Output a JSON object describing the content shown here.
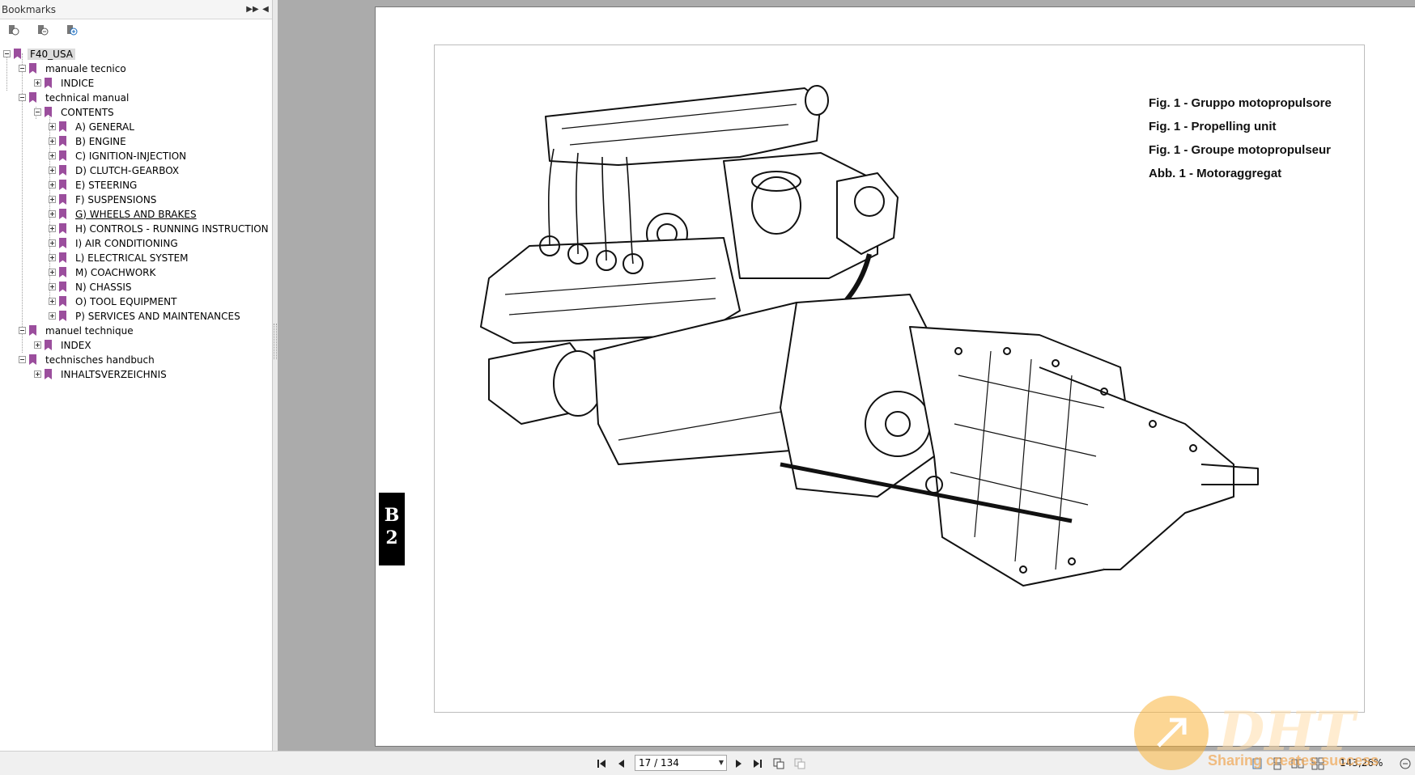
{
  "sidebar": {
    "title": "Bookmarks",
    "header_buttons": [
      "options-icon",
      "collapse-panel-icon"
    ],
    "tools": [
      "expand-bookmark-icon",
      "find-bookmark-icon",
      "add-bookmark-icon"
    ],
    "tree": [
      {
        "label": "F40_USA"
      },
      {
        "label": "manuale tecnico"
      },
      {
        "label": "INDICE"
      },
      {
        "label": "technical manual"
      },
      {
        "label": "CONTENTS"
      },
      {
        "label": "A) GENERAL"
      },
      {
        "label": "B) ENGINE"
      },
      {
        "label": "C) IGNITION-INJECTION"
      },
      {
        "label": "D) CLUTCH-GEARBOX"
      },
      {
        "label": "E) STEERING"
      },
      {
        "label": "F) SUSPENSIONS"
      },
      {
        "label": "G) WHEELS AND BRAKES"
      },
      {
        "label": "H) CONTROLS - RUNNING INSTRUCTION"
      },
      {
        "label": "I) AIR CONDITIONING"
      },
      {
        "label": "L) ELECTRICAL SYSTEM"
      },
      {
        "label": "M) COACHWORK"
      },
      {
        "label": "N) CHASSIS"
      },
      {
        "label": "O) TOOL EQUIPMENT"
      },
      {
        "label": "P) SERVICES AND MAINTENANCES"
      },
      {
        "label": "manuel technique"
      },
      {
        "label": "INDEX"
      },
      {
        "label": "technisches handbuch"
      },
      {
        "label": "INHALTSVERZEICHNIS"
      }
    ]
  },
  "document": {
    "section_tab": {
      "letter": "B",
      "number": "2"
    },
    "captions": [
      "Fig. 1 - Gruppo motopropulsore",
      "Fig. 1 - Propelling unit",
      "Fig. 1 - Groupe motopropulseur",
      "Abb. 1 - Motoraggregat"
    ],
    "figure": "engine-and-gearbox-drawing"
  },
  "statusbar": {
    "page_value": "17 / 134",
    "zoom": "143,26%"
  },
  "watermark": {
    "logo": "DHT",
    "text": "Sharing creates success"
  },
  "colors": {
    "bookmark": "#9b4e9d",
    "workspace": "#ababab",
    "watermark": "#f0a040"
  }
}
